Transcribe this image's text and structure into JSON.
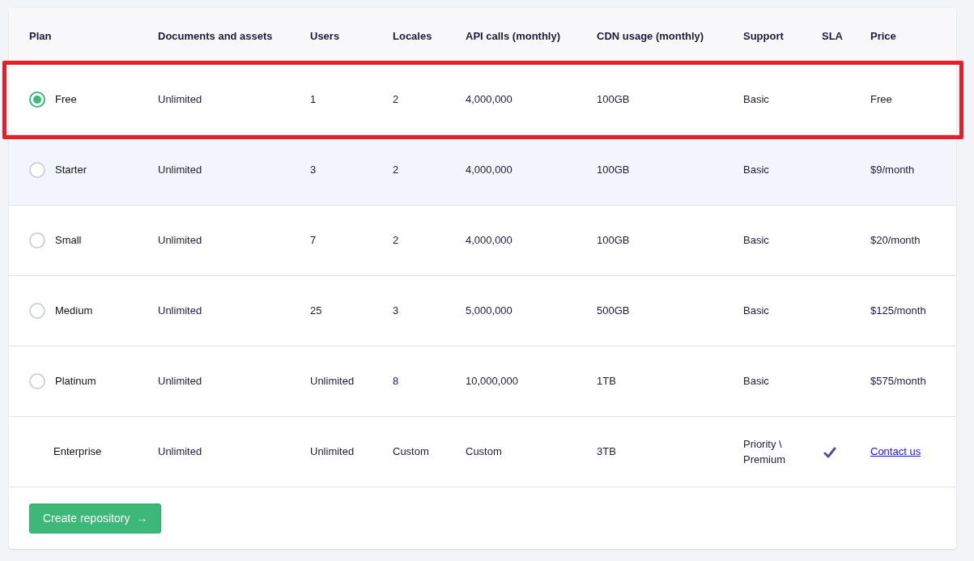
{
  "table": {
    "columns": [
      "Plan",
      "Documents and assets",
      "Users",
      "Locales",
      "API calls (monthly)",
      "CDN usage (monthly)",
      "Support",
      "SLA",
      "Price"
    ],
    "rows": [
      {
        "kind": "selectable",
        "selected": true,
        "hovered": false,
        "plan": "Free",
        "documents": "Unlimited",
        "users": "1",
        "locales": "2",
        "api_calls": "4,000,000",
        "cdn": "100GB",
        "support": "Basic",
        "sla": false,
        "price": "Free"
      },
      {
        "kind": "selectable",
        "selected": false,
        "hovered": true,
        "plan": "Starter",
        "documents": "Unlimited",
        "users": "3",
        "locales": "2",
        "api_calls": "4,000,000",
        "cdn": "100GB",
        "support": "Basic",
        "sla": false,
        "price": "$9/month"
      },
      {
        "kind": "selectable",
        "selected": false,
        "hovered": false,
        "plan": "Small",
        "documents": "Unlimited",
        "users": "7",
        "locales": "2",
        "api_calls": "4,000,000",
        "cdn": "100GB",
        "support": "Basic",
        "sla": false,
        "price": "$20/month"
      },
      {
        "kind": "selectable",
        "selected": false,
        "hovered": false,
        "plan": "Medium",
        "documents": "Unlimited",
        "users": "25",
        "locales": "3",
        "api_calls": "5,000,000",
        "cdn": "500GB",
        "support": "Basic",
        "sla": false,
        "price": "$125/month"
      },
      {
        "kind": "selectable",
        "selected": false,
        "hovered": false,
        "plan": "Platinum",
        "documents": "Unlimited",
        "users": "Unlimited",
        "locales": "8",
        "api_calls": "10,000,000",
        "cdn": "1TB",
        "support": "Basic",
        "sla": false,
        "price": "$575/month"
      },
      {
        "kind": "contact",
        "selected": false,
        "hovered": false,
        "plan": "Enterprise",
        "documents": "Unlimited",
        "users": "Unlimited",
        "locales": "Custom",
        "api_calls": "Custom",
        "cdn": "3TB",
        "support": "Priority \\ Premium",
        "sla": true,
        "price": "Contact us"
      }
    ]
  },
  "button": {
    "label": "Create repository",
    "arrow": "→"
  }
}
